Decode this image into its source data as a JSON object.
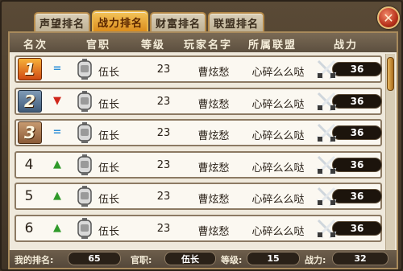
{
  "tabs": [
    "声望排名",
    "战力排名",
    "财富排名",
    "联盟排名"
  ],
  "active_tab": 1,
  "close_label": "✕",
  "columns": [
    "名次",
    "官职",
    "等级",
    "玩家名字",
    "所属联盟",
    "战力"
  ],
  "rows": [
    {
      "rank": "1",
      "trend": "same",
      "trend_symbol": "=",
      "title": "伍长",
      "level": "23",
      "name": "曹炫愁",
      "alliance": "心碎么么哒",
      "power": "36"
    },
    {
      "rank": "2",
      "trend": "down",
      "trend_symbol": "▼",
      "title": "伍长",
      "level": "23",
      "name": "曹炫愁",
      "alliance": "心碎么么哒",
      "power": "36"
    },
    {
      "rank": "3",
      "trend": "same",
      "trend_symbol": "=",
      "title": "伍长",
      "level": "23",
      "name": "曹炫愁",
      "alliance": "心碎么么哒",
      "power": "36"
    },
    {
      "rank": "4",
      "trend": "up",
      "trend_symbol": "▲",
      "title": "伍长",
      "level": "23",
      "name": "曹炫愁",
      "alliance": "心碎么么哒",
      "power": "36"
    },
    {
      "rank": "5",
      "trend": "up",
      "trend_symbol": "▲",
      "title": "伍长",
      "level": "23",
      "name": "曹炫愁",
      "alliance": "心碎么么哒",
      "power": "36"
    },
    {
      "rank": "6",
      "trend": "up",
      "trend_symbol": "▲",
      "title": "伍长",
      "level": "23",
      "name": "曹炫愁",
      "alliance": "心碎么么哒",
      "power": "36"
    }
  ],
  "footer": {
    "my_rank_label": "我的排名:",
    "my_rank": "65",
    "title_label": "官职:",
    "title": "伍长",
    "level_label": "等级:",
    "level": "15",
    "power_label": "战力:",
    "power": "32"
  },
  "colors": {
    "accent": "#e8a23a",
    "rank1": "#d04a14",
    "rank2": "#3f5a78",
    "rank3": "#8a5a36"
  }
}
